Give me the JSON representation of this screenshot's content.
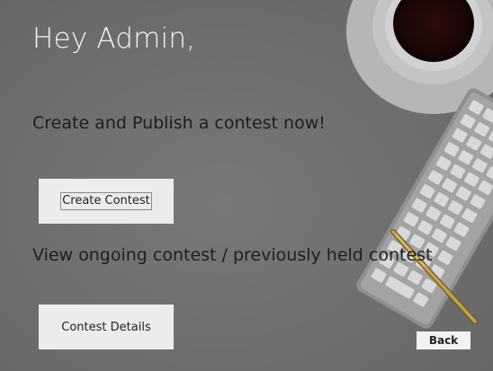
{
  "greeting": "Hey Admin,",
  "create_section": {
    "prompt": "Create and Publish a contest now!",
    "button_label": "Create Contest"
  },
  "view_section": {
    "prompt": "View ongoing contest / previously held contest",
    "button_label": "Contest Details"
  },
  "back_button_label": "Back",
  "colors": {
    "background": "#6e6e6e",
    "greeting_text": "#f4f4f4",
    "prompt_text": "#1e1e1e",
    "button_bg": "#ececec"
  },
  "background_image": {
    "objects": [
      "coffee-cup",
      "keyboard",
      "pen"
    ]
  }
}
